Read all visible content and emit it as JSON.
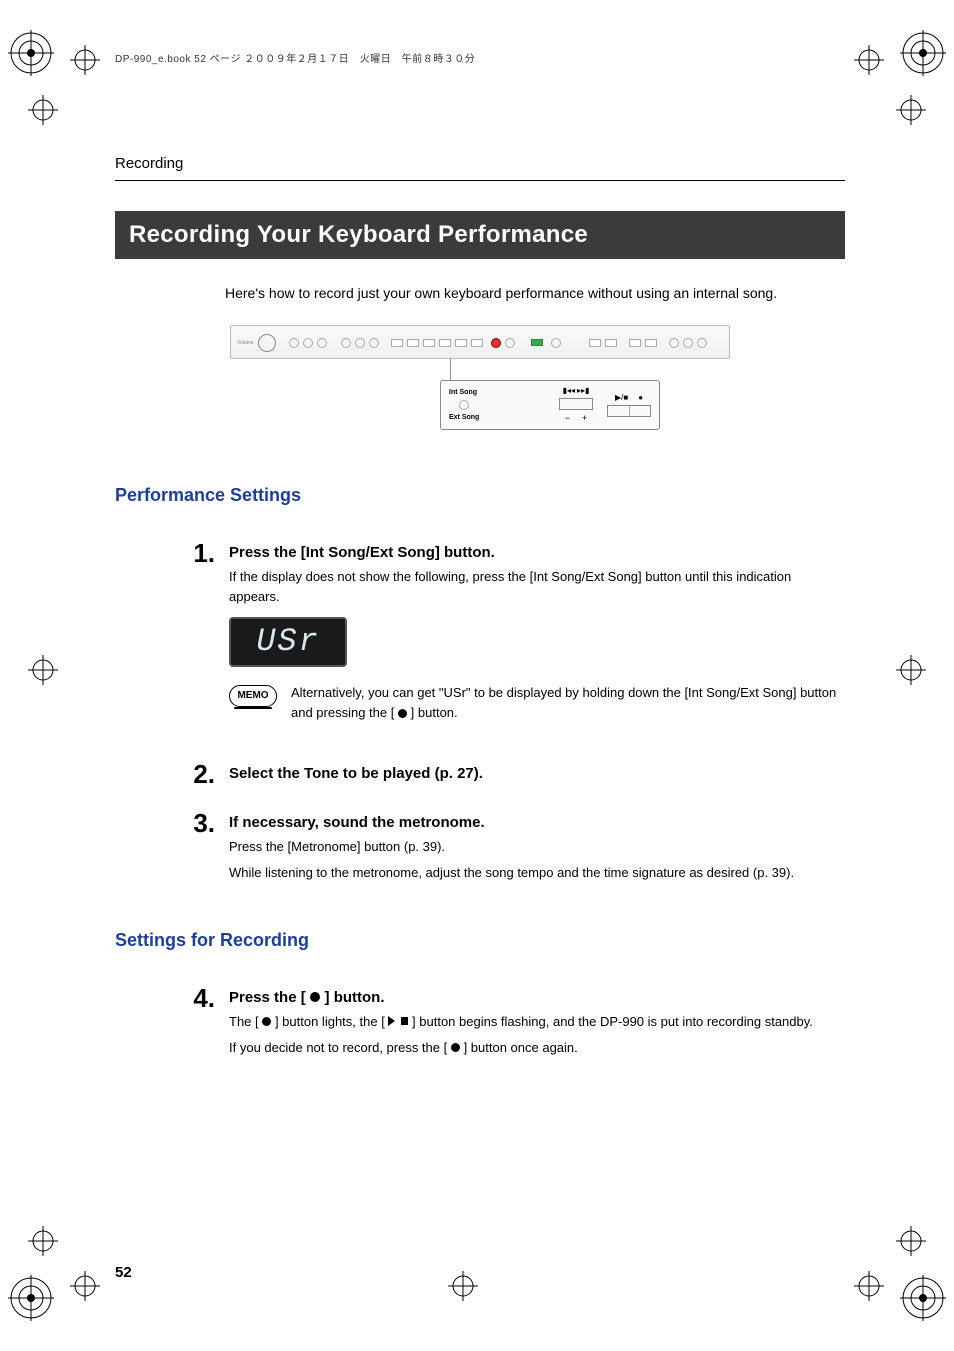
{
  "meta": {
    "book_line": "DP-990_e.book  52 ページ  ２００９年２月１７日　火曜日　午前８時３０分"
  },
  "header": {
    "section": "Recording"
  },
  "title": "Recording Your Keyboard Performance",
  "intro": "Here's how to record just your own keyboard performance without using an internal song.",
  "panel": {
    "int_song": "Int Song",
    "ext_song": "Ext Song"
  },
  "section_a": {
    "heading": "Performance Settings",
    "steps": [
      {
        "num": "1.",
        "title": "Press the [Int Song/Ext Song] button.",
        "text1": "If the display does not show the following, press the [Int Song/Ext Song] button until this indication appears.",
        "lcd": "USr",
        "memo_label": "MEMO",
        "memo_text_a": "Alternatively, you can get \"USr\" to be displayed by holding down the [Int Song/Ext Song] button and pressing the [ ",
        "memo_text_b": " ] button."
      },
      {
        "num": "2.",
        "title": "Select the Tone to be played (p. 27)."
      },
      {
        "num": "3.",
        "title": "If necessary, sound the metronome.",
        "text1": "Press the [Metronome] button (p. 39).",
        "text2": "While listening to the metronome, adjust the song tempo and the time signature as desired (p. 39)."
      }
    ]
  },
  "section_b": {
    "heading": "Settings for Recording",
    "steps": [
      {
        "num": "4.",
        "title_a": "Press the [ ",
        "title_b": " ] button.",
        "text1a": "The [ ",
        "text1b": " ] button lights, the [ ",
        "text1c": " ] button begins flashing, and the DP-990 is put into recording standby.",
        "text2a": "If you decide not to record, press the [ ",
        "text2b": " ] button once again."
      }
    ]
  },
  "page_number": "52"
}
